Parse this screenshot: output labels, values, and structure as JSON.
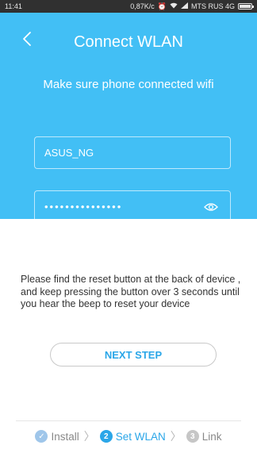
{
  "status_bar": {
    "time": "11:41",
    "speed": "0,87K/c",
    "carrier": "MTS RUS 4G",
    "icons": [
      "alarm-icon",
      "wifi-icon",
      "signal-icon",
      "battery-icon"
    ]
  },
  "header": {
    "title": "Connect WLAN",
    "back_icon": "chevron-left-icon"
  },
  "subtitle": "Make sure phone connected wifi",
  "ssid_field": {
    "value": "ASUS_NG"
  },
  "password_field": {
    "masked_value": "•••••••••••••••",
    "toggle_icon": "eye-icon"
  },
  "instructions": "Please find the reset button at the back of device , and keep pressing the button over 3 seconds until you hear the beep to reset your device",
  "next_button": {
    "label": "NEXT STEP"
  },
  "steps": [
    {
      "label": "Install",
      "marker": "✓",
      "state": "done"
    },
    {
      "label": "Set WLAN",
      "marker": "2",
      "state": "active"
    },
    {
      "label": "Link",
      "marker": "3",
      "state": "pending"
    }
  ],
  "colors": {
    "hero": "#42bff5",
    "accent": "#2aa6e8",
    "status_bar": "#303030"
  }
}
